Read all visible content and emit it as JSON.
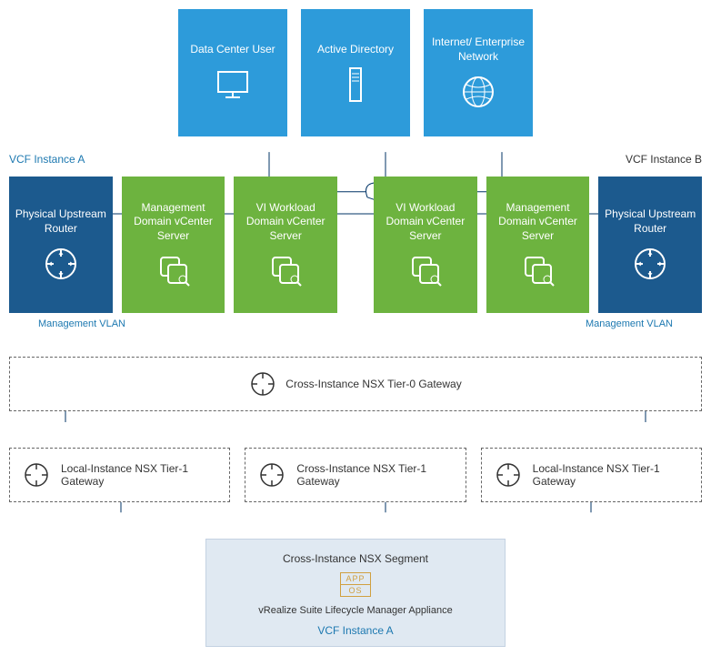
{
  "top": [
    {
      "label": "Data Center User",
      "icon": "monitor"
    },
    {
      "label": "Active Directory",
      "icon": "server"
    },
    {
      "label": "Internet/ Enterprise Network",
      "icon": "globe"
    }
  ],
  "instanceA": "VCF Instance A",
  "instanceB": "VCF Instance B",
  "mid": {
    "a": [
      {
        "label": "Physical Upstream Router",
        "cls": "blue-dark phys",
        "icon": "router"
      },
      {
        "label": "Management Domain vCenter Server",
        "cls": "green",
        "icon": "vcenter"
      },
      {
        "label": "VI Workload Domain vCenter Server",
        "cls": "green",
        "icon": "vcenter"
      }
    ],
    "b": [
      {
        "label": "VI Workload Domain vCenter Server",
        "cls": "green",
        "icon": "vcenter"
      },
      {
        "label": "Management Domain vCenter Server",
        "cls": "green",
        "icon": "vcenter"
      },
      {
        "label": "Physical Upstream Router",
        "cls": "blue-dark phys",
        "icon": "router"
      }
    ]
  },
  "vlanA": "Management VLAN",
  "vlanB": "Management VLAN",
  "tier0": "Cross-Instance NSX Tier-0 Gateway",
  "tier1": [
    "Local-Instance NSX Tier-1 Gateway",
    "Cross-Instance NSX Tier-1 Gateway",
    "Local-Instance NSX Tier-1 Gateway"
  ],
  "segmentTitle": "Cross-Instance NSX Segment",
  "segmentApp": "vRealize Suite Lifecycle Manager Appliance",
  "segmentInstance": "VCF Instance A",
  "appIcon": {
    "top": "APP",
    "bottom": "OS"
  }
}
